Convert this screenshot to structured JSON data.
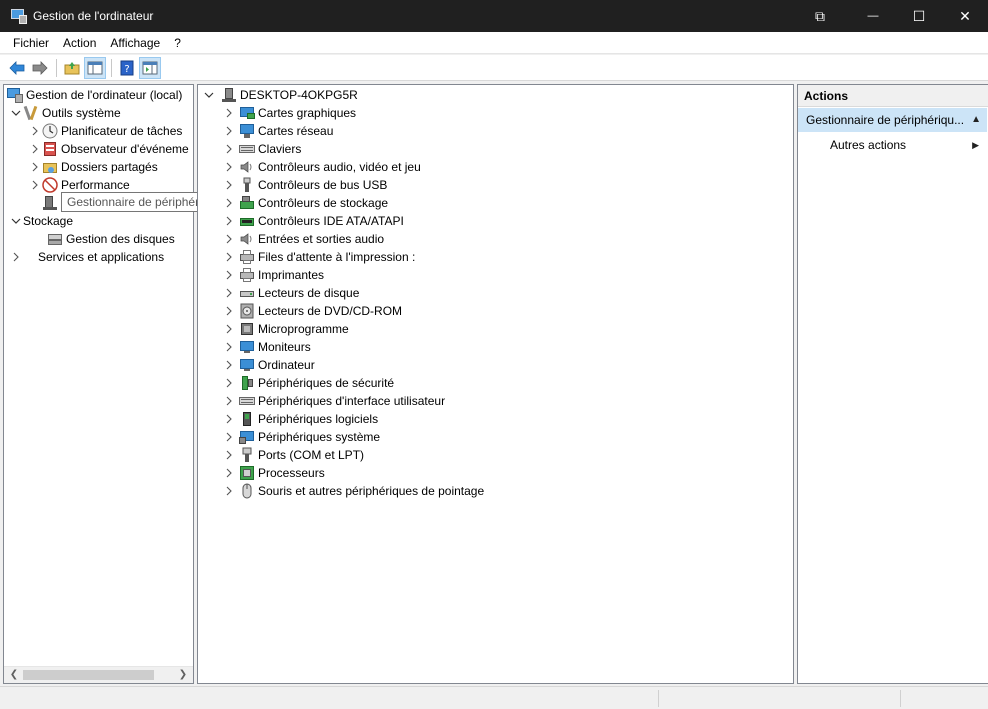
{
  "window": {
    "title": "Gestion de l'ordinateur",
    "controls": {
      "snap": "⧉",
      "minimize": "—",
      "maximize": "☐",
      "close": "✕"
    }
  },
  "menu": {
    "items": [
      "Fichier",
      "Action",
      "Affichage",
      "?"
    ]
  },
  "toolbar": {
    "back": "back-arrow-icon",
    "forward": "forward-arrow-icon",
    "up": "folder-up-icon",
    "show_hide_tree": "console-tree-icon",
    "help": "help-icon",
    "show_action_pane": "action-pane-icon"
  },
  "tree": {
    "root": "Gestion de l'ordinateur (local)",
    "system_tools": "Outils système",
    "task_scheduler": "Planificateur de tâches",
    "event_viewer": "Observateur d'événeme",
    "shared_folders": "Dossiers partagés",
    "performance": "Performance",
    "device_manager": "Gestionnaire de périphériques",
    "storage": "Stockage",
    "disk_management": "Gestion des disques",
    "services_apps": "Services et applications"
  },
  "tooltip": "Gestionnaire de périphériques",
  "devices": {
    "computer": "DESKTOP-4OKPG5R",
    "categories": [
      "Cartes graphiques",
      "Cartes réseau",
      "Claviers",
      "Contrôleurs audio, vidéo et jeu",
      "Contrôleurs de bus USB",
      "Contrôleurs de stockage",
      "Contrôleurs IDE ATA/ATAPI",
      "Entrées et sorties audio",
      "Files d'attente à l'impression :",
      "Imprimantes",
      "Lecteurs de disque",
      "Lecteurs de DVD/CD-ROM",
      "Microprogramme",
      "Moniteurs",
      "Ordinateur",
      "Périphériques de sécurité",
      "Périphériques d'interface utilisateur",
      "Périphériques logiciels",
      "Périphériques système",
      "Ports (COM et LPT)",
      "Processeurs",
      "Souris et autres périphériques de pointage"
    ]
  },
  "actions": {
    "header": "Actions",
    "selected": "Gestionnaire de périphériqu...",
    "more": "Autres actions"
  },
  "colors": {
    "titlebar": "#202020",
    "selection": "#cce4f7",
    "accent": "#3b8fd6"
  }
}
